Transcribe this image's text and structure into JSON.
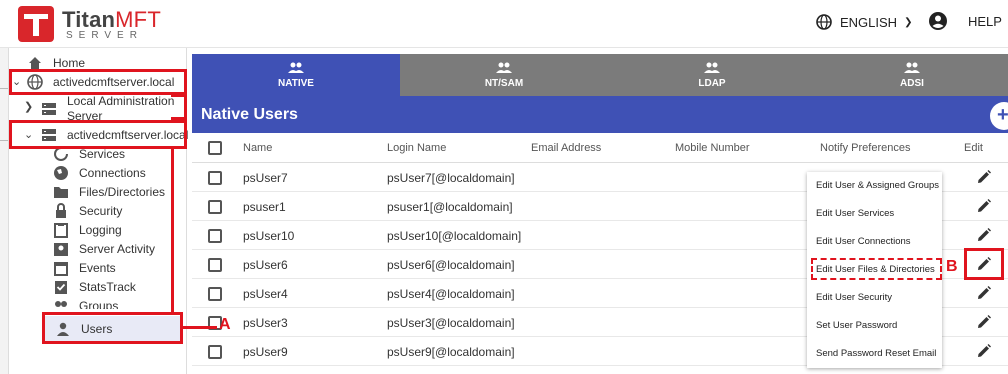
{
  "header": {
    "brand_main": "Titan",
    "brand_accent": "MFT",
    "brand_sub": "SERVER",
    "language": "ENGLISH",
    "help": "HELP"
  },
  "sidebar": {
    "home": "Home",
    "server1": "activedcmftserver.local",
    "local_admin": "Local Administration Server",
    "server2": "activedcmftserver.local",
    "items": [
      {
        "label": "Services",
        "icon": "refresh-icon"
      },
      {
        "label": "Connections",
        "icon": "globe-icon"
      },
      {
        "label": "Files/Directories",
        "icon": "folder-icon"
      },
      {
        "label": "Security",
        "icon": "lock-icon"
      },
      {
        "label": "Logging",
        "icon": "clipboard-icon"
      },
      {
        "label": "Server Activity",
        "icon": "badge-icon"
      },
      {
        "label": "Events",
        "icon": "calendar-icon"
      },
      {
        "label": "StatsTrack",
        "icon": "checklist-icon"
      },
      {
        "label": "Groups",
        "icon": "group-icon"
      },
      {
        "label": "Users",
        "icon": "person-icon"
      }
    ]
  },
  "tabs": [
    {
      "label": "NATIVE",
      "active": true
    },
    {
      "label": "NT/SAM",
      "active": false
    },
    {
      "label": "LDAP",
      "active": false
    },
    {
      "label": "ADSI",
      "active": false
    }
  ],
  "title": "Native Users",
  "add_label": "+",
  "table": {
    "columns": [
      "Name",
      "Login Name",
      "Email Address",
      "Mobile Number",
      "Notify Preferences",
      "Edit"
    ],
    "rows": [
      {
        "name": "psUser7",
        "login": "psUser7[@localdomain]"
      },
      {
        "name": "psuser1",
        "login": "psuser1[@localdomain]"
      },
      {
        "name": "psUser10",
        "login": "psUser10[@localdomain]"
      },
      {
        "name": "psUser6",
        "login": "psUser6[@localdomain]"
      },
      {
        "name": "psUser4",
        "login": "psUser4[@localdomain]"
      },
      {
        "name": "psUser3",
        "login": "psUser3[@localdomain]"
      },
      {
        "name": "psUser9",
        "login": "psUser9[@localdomain]"
      }
    ]
  },
  "menu": [
    "Edit User & Assigned Groups",
    "Edit User Services",
    "Edit User Connections",
    "Edit User Files & Directories",
    "Edit User Security",
    "Set User Password",
    "Send Password Reset Email"
  ],
  "annotations": {
    "a": "A",
    "b": "B"
  },
  "colors": {
    "accent": "#3f51b5",
    "tab_inactive": "#7b7b7b",
    "annotation": "#e0141e",
    "brand": "#d9262b"
  }
}
